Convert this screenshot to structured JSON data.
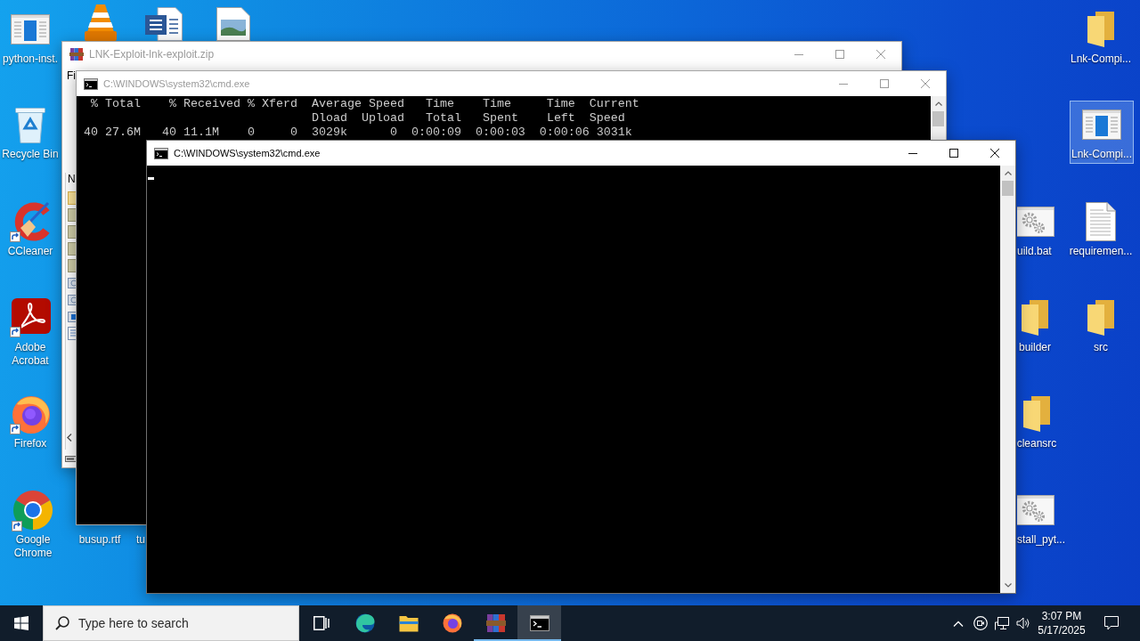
{
  "desktop_icons": [
    {
      "label": "python-inst.",
      "selected": false
    },
    {
      "label": "Recycle Bin",
      "selected": false
    },
    {
      "label": "CCleaner",
      "selected": false
    },
    {
      "label": "Adobe Acrobat",
      "selected": false
    },
    {
      "label": "Firefox",
      "selected": false
    },
    {
      "label": "Google Chrome",
      "selected": false
    },
    {
      "label": "busup.rtf",
      "selected": false
    },
    {
      "label": "tu",
      "selected": false
    },
    {
      "label": "Lnk-Compi...",
      "selected": false
    },
    {
      "label": "Lnk-Compi...",
      "selected": true
    },
    {
      "label": "uild.bat",
      "selected": false
    },
    {
      "label": "requiremen...",
      "selected": false
    },
    {
      "label": "builder",
      "selected": false
    },
    {
      "label": "src",
      "selected": false
    },
    {
      "label": "cleansrc",
      "selected": false
    },
    {
      "label": "stall_pyt...",
      "selected": false
    }
  ],
  "windows": [
    {
      "kind": "archive",
      "title": "LNK-Exploit-lnk-exploit.zip",
      "active": false,
      "menu": [
        "Fi"
      ],
      "columns": [
        "N"
      ]
    },
    {
      "kind": "console",
      "title": "C:\\WINDOWS\\system32\\cmd.exe",
      "active": false,
      "lines": [
        "  % Total    % Received % Xferd  Average Speed   Time    Time     Time  Current",
        "                                 Dload  Upload   Total   Spent    Left  Speed",
        " 40 27.6M   40 11.1M    0     0  3029k      0  0:00:09  0:00:03  0:00:06 3031k"
      ]
    },
    {
      "kind": "console",
      "title": "C:\\WINDOWS\\system32\\cmd.exe",
      "active": true
    }
  ],
  "taskbar": {
    "search": {
      "placeholder": "Type here to search"
    },
    "apps": [
      {
        "running": false,
        "selected": false
      },
      {
        "running": false,
        "selected": false
      },
      {
        "running": false,
        "selected": false
      },
      {
        "running": true,
        "selected": false
      },
      {
        "running": true,
        "selected": true
      }
    ],
    "time": "3:07 PM",
    "date": "5/17/2025"
  }
}
